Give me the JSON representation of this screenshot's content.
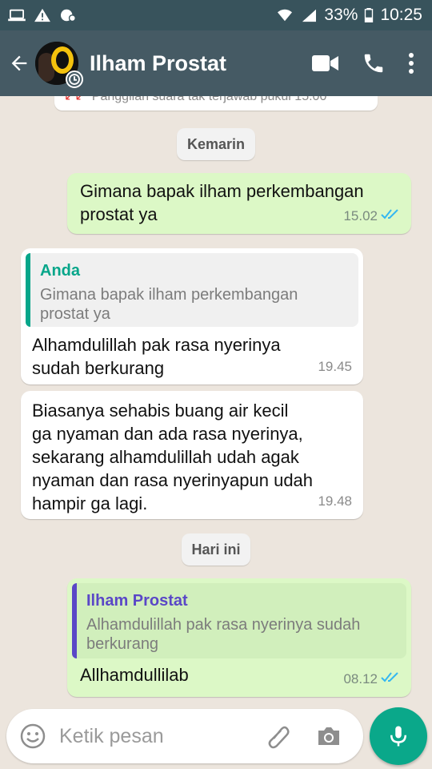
{
  "status_bar": {
    "battery": "33%",
    "time": "10:25"
  },
  "header": {
    "contact_name": "Ilham Prostat"
  },
  "chat": {
    "truncated_notice": "Panggilan suara tak terjawab pukul 15.00",
    "day_chips": [
      "Kemarin",
      "Hari ini"
    ],
    "messages": [
      {
        "direction": "out",
        "text_lines": [
          "Gimana bapak ilham perkembangan",
          "prostat ya"
        ],
        "time": "15.02"
      },
      {
        "direction": "in",
        "quote_name": "Anda",
        "quote_lines": [
          "Gimana bapak ilham perkembangan",
          "prostat ya"
        ],
        "text_lines": [
          "Alhamdulillah pak rasa nyerinya",
          "sudah berkurang"
        ],
        "time": "19.45"
      },
      {
        "direction": "in",
        "text_lines": [
          "Biasanya sehabis buang air kecil",
          "ga nyaman dan ada rasa nyerinya,",
          "sekarang alhamdulillah udah agak",
          "nyaman dan rasa nyerinyapun udah",
          "hampir ga lagi."
        ],
        "time": "19.48"
      },
      {
        "direction": "out",
        "quote_name": "Ilham Prostat",
        "quote_lines": [
          "Alhamdulillah pak rasa nyerinya sudah",
          "berkurang"
        ],
        "text_lines": [
          "Allhamdullilab"
        ],
        "time": "08.12"
      }
    ]
  },
  "composer": {
    "placeholder": "Ketik pesan"
  },
  "colors": {
    "appbar": "#455a64",
    "statusbar": "#38535c",
    "outgoing_bubble": "#dcf8c6",
    "incoming_bubble": "#ffffff",
    "quote_you": "#06a68a",
    "quote_contact": "#5a47c7",
    "read_ticks": "#34b7f1",
    "mic_button": "#0aa88a"
  }
}
